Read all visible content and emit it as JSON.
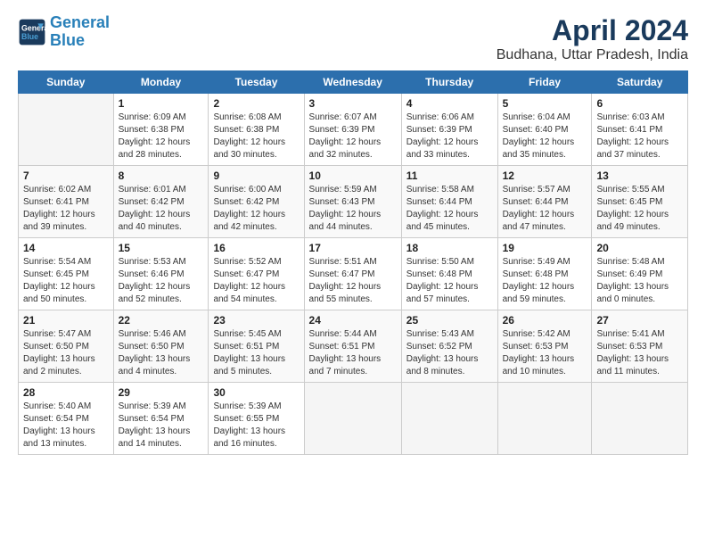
{
  "header": {
    "logo_line1": "General",
    "logo_line2": "Blue",
    "title": "April 2024",
    "subtitle": "Budhana, Uttar Pradesh, India"
  },
  "columns": [
    "Sunday",
    "Monday",
    "Tuesday",
    "Wednesday",
    "Thursday",
    "Friday",
    "Saturday"
  ],
  "rows": [
    [
      {
        "day": "",
        "text": ""
      },
      {
        "day": "1",
        "text": "Sunrise: 6:09 AM\nSunset: 6:38 PM\nDaylight: 12 hours\nand 28 minutes."
      },
      {
        "day": "2",
        "text": "Sunrise: 6:08 AM\nSunset: 6:38 PM\nDaylight: 12 hours\nand 30 minutes."
      },
      {
        "day": "3",
        "text": "Sunrise: 6:07 AM\nSunset: 6:39 PM\nDaylight: 12 hours\nand 32 minutes."
      },
      {
        "day": "4",
        "text": "Sunrise: 6:06 AM\nSunset: 6:39 PM\nDaylight: 12 hours\nand 33 minutes."
      },
      {
        "day": "5",
        "text": "Sunrise: 6:04 AM\nSunset: 6:40 PM\nDaylight: 12 hours\nand 35 minutes."
      },
      {
        "day": "6",
        "text": "Sunrise: 6:03 AM\nSunset: 6:41 PM\nDaylight: 12 hours\nand 37 minutes."
      }
    ],
    [
      {
        "day": "7",
        "text": "Sunrise: 6:02 AM\nSunset: 6:41 PM\nDaylight: 12 hours\nand 39 minutes."
      },
      {
        "day": "8",
        "text": "Sunrise: 6:01 AM\nSunset: 6:42 PM\nDaylight: 12 hours\nand 40 minutes."
      },
      {
        "day": "9",
        "text": "Sunrise: 6:00 AM\nSunset: 6:42 PM\nDaylight: 12 hours\nand 42 minutes."
      },
      {
        "day": "10",
        "text": "Sunrise: 5:59 AM\nSunset: 6:43 PM\nDaylight: 12 hours\nand 44 minutes."
      },
      {
        "day": "11",
        "text": "Sunrise: 5:58 AM\nSunset: 6:44 PM\nDaylight: 12 hours\nand 45 minutes."
      },
      {
        "day": "12",
        "text": "Sunrise: 5:57 AM\nSunset: 6:44 PM\nDaylight: 12 hours\nand 47 minutes."
      },
      {
        "day": "13",
        "text": "Sunrise: 5:55 AM\nSunset: 6:45 PM\nDaylight: 12 hours\nand 49 minutes."
      }
    ],
    [
      {
        "day": "14",
        "text": "Sunrise: 5:54 AM\nSunset: 6:45 PM\nDaylight: 12 hours\nand 50 minutes."
      },
      {
        "day": "15",
        "text": "Sunrise: 5:53 AM\nSunset: 6:46 PM\nDaylight: 12 hours\nand 52 minutes."
      },
      {
        "day": "16",
        "text": "Sunrise: 5:52 AM\nSunset: 6:47 PM\nDaylight: 12 hours\nand 54 minutes."
      },
      {
        "day": "17",
        "text": "Sunrise: 5:51 AM\nSunset: 6:47 PM\nDaylight: 12 hours\nand 55 minutes."
      },
      {
        "day": "18",
        "text": "Sunrise: 5:50 AM\nSunset: 6:48 PM\nDaylight: 12 hours\nand 57 minutes."
      },
      {
        "day": "19",
        "text": "Sunrise: 5:49 AM\nSunset: 6:48 PM\nDaylight: 12 hours\nand 59 minutes."
      },
      {
        "day": "20",
        "text": "Sunrise: 5:48 AM\nSunset: 6:49 PM\nDaylight: 13 hours\nand 0 minutes."
      }
    ],
    [
      {
        "day": "21",
        "text": "Sunrise: 5:47 AM\nSunset: 6:50 PM\nDaylight: 13 hours\nand 2 minutes."
      },
      {
        "day": "22",
        "text": "Sunrise: 5:46 AM\nSunset: 6:50 PM\nDaylight: 13 hours\nand 4 minutes."
      },
      {
        "day": "23",
        "text": "Sunrise: 5:45 AM\nSunset: 6:51 PM\nDaylight: 13 hours\nand 5 minutes."
      },
      {
        "day": "24",
        "text": "Sunrise: 5:44 AM\nSunset: 6:51 PM\nDaylight: 13 hours\nand 7 minutes."
      },
      {
        "day": "25",
        "text": "Sunrise: 5:43 AM\nSunset: 6:52 PM\nDaylight: 13 hours\nand 8 minutes."
      },
      {
        "day": "26",
        "text": "Sunrise: 5:42 AM\nSunset: 6:53 PM\nDaylight: 13 hours\nand 10 minutes."
      },
      {
        "day": "27",
        "text": "Sunrise: 5:41 AM\nSunset: 6:53 PM\nDaylight: 13 hours\nand 11 minutes."
      }
    ],
    [
      {
        "day": "28",
        "text": "Sunrise: 5:40 AM\nSunset: 6:54 PM\nDaylight: 13 hours\nand 13 minutes."
      },
      {
        "day": "29",
        "text": "Sunrise: 5:39 AM\nSunset: 6:54 PM\nDaylight: 13 hours\nand 14 minutes."
      },
      {
        "day": "30",
        "text": "Sunrise: 5:39 AM\nSunset: 6:55 PM\nDaylight: 13 hours\nand 16 minutes."
      },
      {
        "day": "",
        "text": ""
      },
      {
        "day": "",
        "text": ""
      },
      {
        "day": "",
        "text": ""
      },
      {
        "day": "",
        "text": ""
      }
    ]
  ]
}
